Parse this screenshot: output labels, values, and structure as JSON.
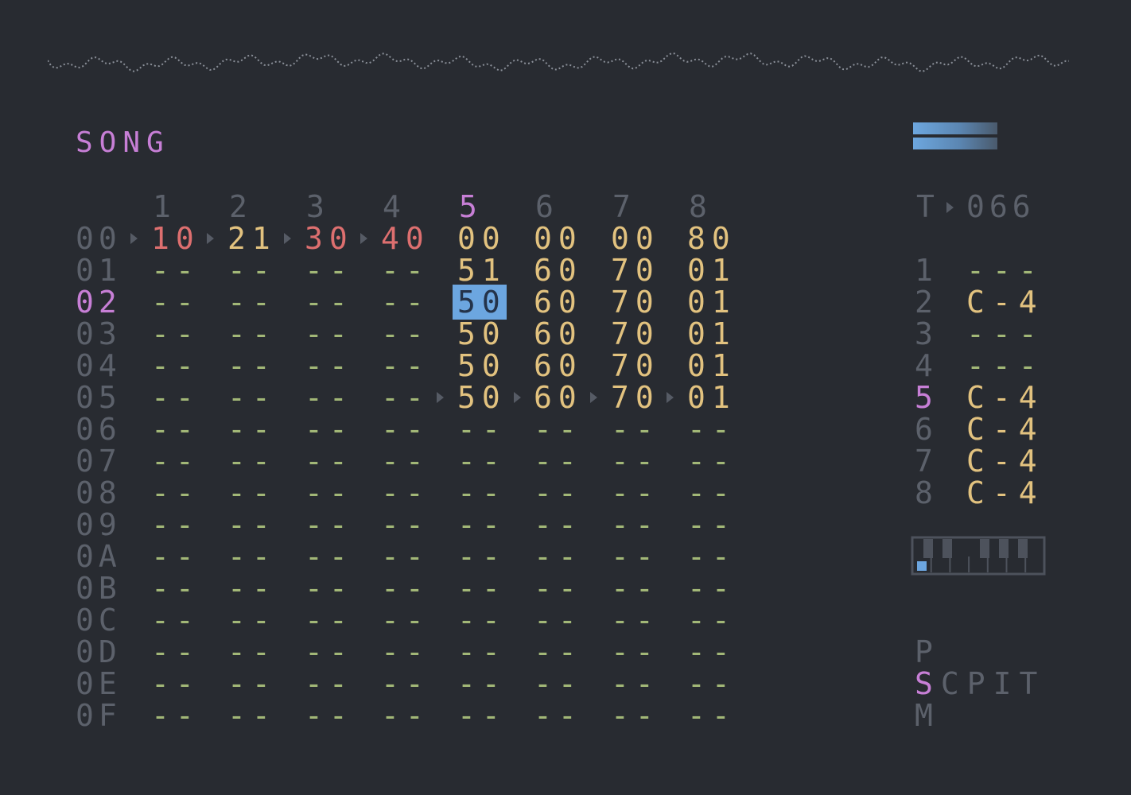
{
  "title": "SONG",
  "channels": [
    "1",
    "2",
    "3",
    "4",
    "5",
    "6",
    "7",
    "8"
  ],
  "active_channel": 5,
  "rows": [
    {
      "idx": "00",
      "cells": [
        "10",
        "21",
        "30",
        "40",
        "00",
        "00",
        "00",
        "80"
      ]
    },
    {
      "idx": "01",
      "cells": [
        "--",
        "--",
        "--",
        "--",
        "51",
        "60",
        "70",
        "01"
      ]
    },
    {
      "idx": "02",
      "cells": [
        "--",
        "--",
        "--",
        "--",
        "50",
        "60",
        "70",
        "01"
      ]
    },
    {
      "idx": "03",
      "cells": [
        "--",
        "--",
        "--",
        "--",
        "50",
        "60",
        "70",
        "01"
      ]
    },
    {
      "idx": "04",
      "cells": [
        "--",
        "--",
        "--",
        "--",
        "50",
        "60",
        "70",
        "01"
      ]
    },
    {
      "idx": "05",
      "cells": [
        "--",
        "--",
        "--",
        "--",
        "50",
        "60",
        "70",
        "01"
      ]
    },
    {
      "idx": "06",
      "cells": [
        "--",
        "--",
        "--",
        "--",
        "--",
        "--",
        "--",
        "--"
      ]
    },
    {
      "idx": "07",
      "cells": [
        "--",
        "--",
        "--",
        "--",
        "--",
        "--",
        "--",
        "--"
      ]
    },
    {
      "idx": "08",
      "cells": [
        "--",
        "--",
        "--",
        "--",
        "--",
        "--",
        "--",
        "--"
      ]
    },
    {
      "idx": "09",
      "cells": [
        "--",
        "--",
        "--",
        "--",
        "--",
        "--",
        "--",
        "--"
      ]
    },
    {
      "idx": "0A",
      "cells": [
        "--",
        "--",
        "--",
        "--",
        "--",
        "--",
        "--",
        "--"
      ]
    },
    {
      "idx": "0B",
      "cells": [
        "--",
        "--",
        "--",
        "--",
        "--",
        "--",
        "--",
        "--"
      ]
    },
    {
      "idx": "0C",
      "cells": [
        "--",
        "--",
        "--",
        "--",
        "--",
        "--",
        "--",
        "--"
      ]
    },
    {
      "idx": "0D",
      "cells": [
        "--",
        "--",
        "--",
        "--",
        "--",
        "--",
        "--",
        "--"
      ]
    },
    {
      "idx": "0E",
      "cells": [
        "--",
        "--",
        "--",
        "--",
        "--",
        "--",
        "--",
        "--"
      ]
    },
    {
      "idx": "0F",
      "cells": [
        "--",
        "--",
        "--",
        "--",
        "--",
        "--",
        "--",
        "--"
      ]
    }
  ],
  "active_row": "02",
  "red_cells": [
    "10",
    "30",
    "40"
  ],
  "tempo": {
    "label": "T",
    "value": "066"
  },
  "track_notes": [
    {
      "idx": "1",
      "note": "---"
    },
    {
      "idx": "2",
      "note": "C-4"
    },
    {
      "idx": "3",
      "note": "---"
    },
    {
      "idx": "4",
      "note": "---"
    },
    {
      "idx": "5",
      "note": "C-4"
    },
    {
      "idx": "6",
      "note": "C-4"
    },
    {
      "idx": "7",
      "note": "C-4"
    },
    {
      "idx": "8",
      "note": "C-4"
    }
  ],
  "screen_map": {
    "top": "P",
    "mid_selected": "S",
    "mid_rest": "CPIT",
    "bottom": "M"
  },
  "colors": {
    "background": "#282b31",
    "accent_purple": "#c77fd6",
    "value_yellow": "#e2c27f",
    "value_red": "#dd6f6f",
    "empty_green": "#a2b777",
    "dim_gray": "#5c616b",
    "cursor_blue": "#6ca6e0"
  },
  "icons": [
    "waveform-icon",
    "level-meter-icon",
    "piano-keyboard-icon",
    "play-arrow-icon"
  ]
}
